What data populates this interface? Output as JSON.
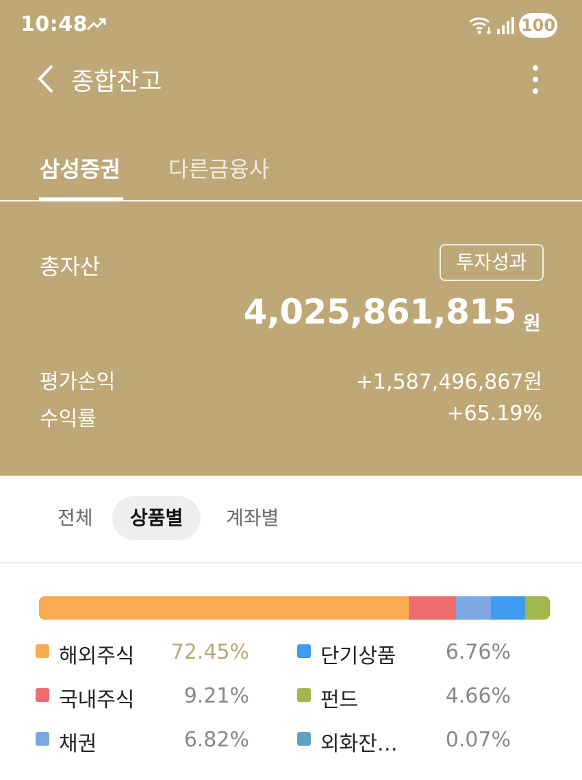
{
  "status_bar": {
    "time": "10:48",
    "battery": "100"
  },
  "header": {
    "title": "종합잔고"
  },
  "tabs": [
    {
      "label": "삼성증권",
      "active": true
    },
    {
      "label": "다른금융사",
      "active": false
    }
  ],
  "summary": {
    "total_label": "총자산",
    "performance_button": "투자성과",
    "total_amount": "4,025,861,815",
    "total_unit": "원",
    "pnl_label": "평가손익",
    "pnl_value": "+1,587,496,867원",
    "return_label": "수익률",
    "return_value": "+65.19%"
  },
  "filters": [
    {
      "label": "전체"
    },
    {
      "label": "상품별",
      "active": true
    },
    {
      "label": "계좌별"
    }
  ],
  "chart_data": {
    "type": "bar",
    "stacked": true,
    "categories": [
      "해외주식",
      "국내주식",
      "채권",
      "단기상품",
      "펀드",
      "외화잔…"
    ],
    "values": [
      72.45,
      9.21,
      6.82,
      6.76,
      4.66,
      0.07
    ],
    "value_labels": [
      "72.45%",
      "9.21%",
      "6.82%",
      "6.76%",
      "4.66%",
      "0.07%"
    ],
    "colors": [
      "#f9ab52",
      "#ee6b6e",
      "#7ea6e3",
      "#3f9cf2",
      "#a2b84a",
      "#5ea3c2"
    ],
    "highlight_index": 0
  },
  "colors": {
    "header_bg": "#bfa877",
    "highlight_text": "#b8a776"
  }
}
